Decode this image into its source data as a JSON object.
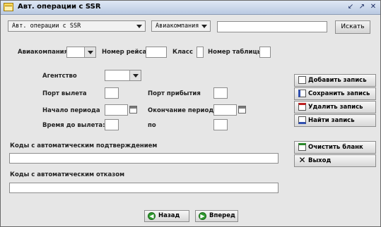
{
  "window": {
    "title": "Авт. операции с SSR",
    "controls": [
      "↙",
      "↗",
      "✕"
    ]
  },
  "search": {
    "operation_select": "Авт. операции с SSR",
    "filter_select": "Авиакомпания",
    "query_value": "",
    "search_button": "Искать"
  },
  "form": {
    "airline_label": "Авиакомпания",
    "flight_label": "Номер рейса",
    "class_label": "Класс",
    "table_label": "Номер таблицы",
    "agency_label": "Агентство",
    "dep_port_label": "Порт вылета",
    "arr_port_label": "Порт прибытия",
    "period_start_label": "Начало периода",
    "period_end_label": "Окончание периода",
    "time_before_label": "Время до вылета: с",
    "time_to_label": "по",
    "auto_confirm_label": "Коды с автоматическим подтверждением",
    "auto_reject_label": "Коды с автоматическим отказом"
  },
  "actions": {
    "add": "Добавить запись",
    "save": "Сохранить запись",
    "delete": "Удалить запись",
    "find": "Найти запись",
    "clear": "Очистить бланк",
    "exit": "Выход"
  },
  "nav": {
    "back": "Назад",
    "forward": "Вперед"
  },
  "colors": {
    "titlebar": "#c9d6ea",
    "window_bg": "#e6e6e6",
    "nav_icon": "#2e9a2e"
  }
}
